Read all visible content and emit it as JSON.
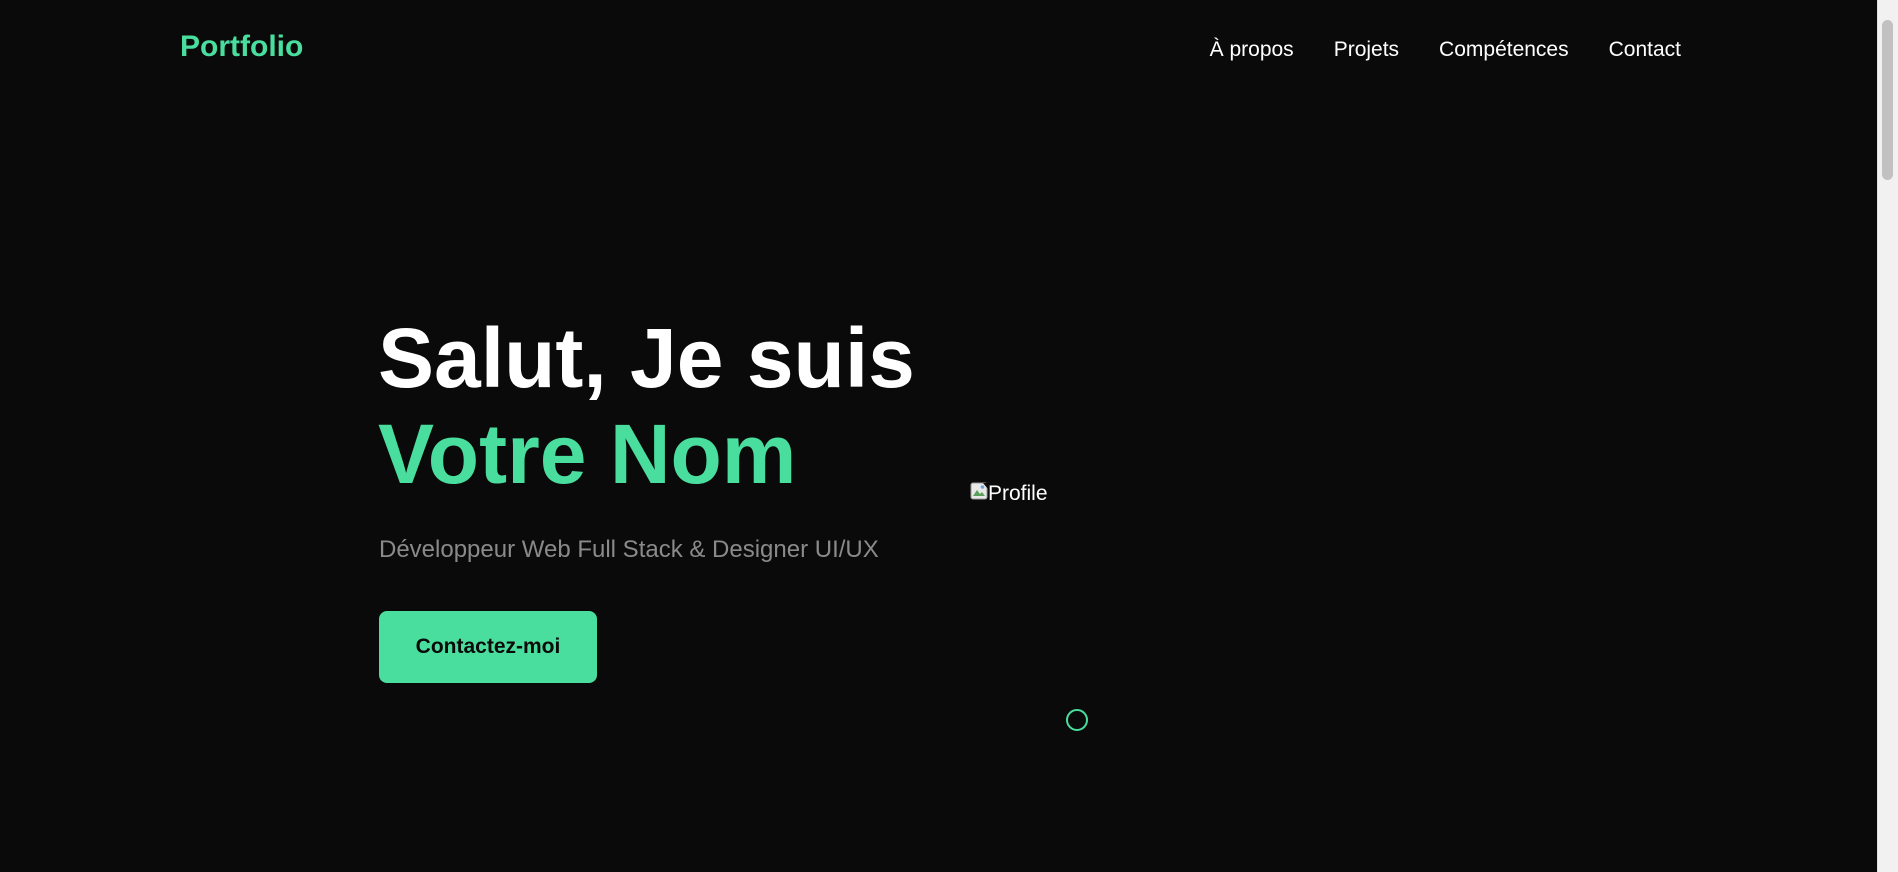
{
  "header": {
    "logo": "Portfolio",
    "nav": [
      {
        "label": "À propos"
      },
      {
        "label": "Projets"
      },
      {
        "label": "Compétences"
      },
      {
        "label": "Contact"
      }
    ]
  },
  "hero": {
    "greeting": "Salut, Je suis",
    "name": "Votre Nom",
    "subtitle": "Développeur Web Full Stack & Designer UI/UX",
    "cta_label": "Contactez-moi",
    "profile_alt": "Profile"
  },
  "colors": {
    "background": "#0a0a0a",
    "accent": "#4ade9e",
    "text": "#ffffff",
    "muted": "#8a8a8a"
  }
}
